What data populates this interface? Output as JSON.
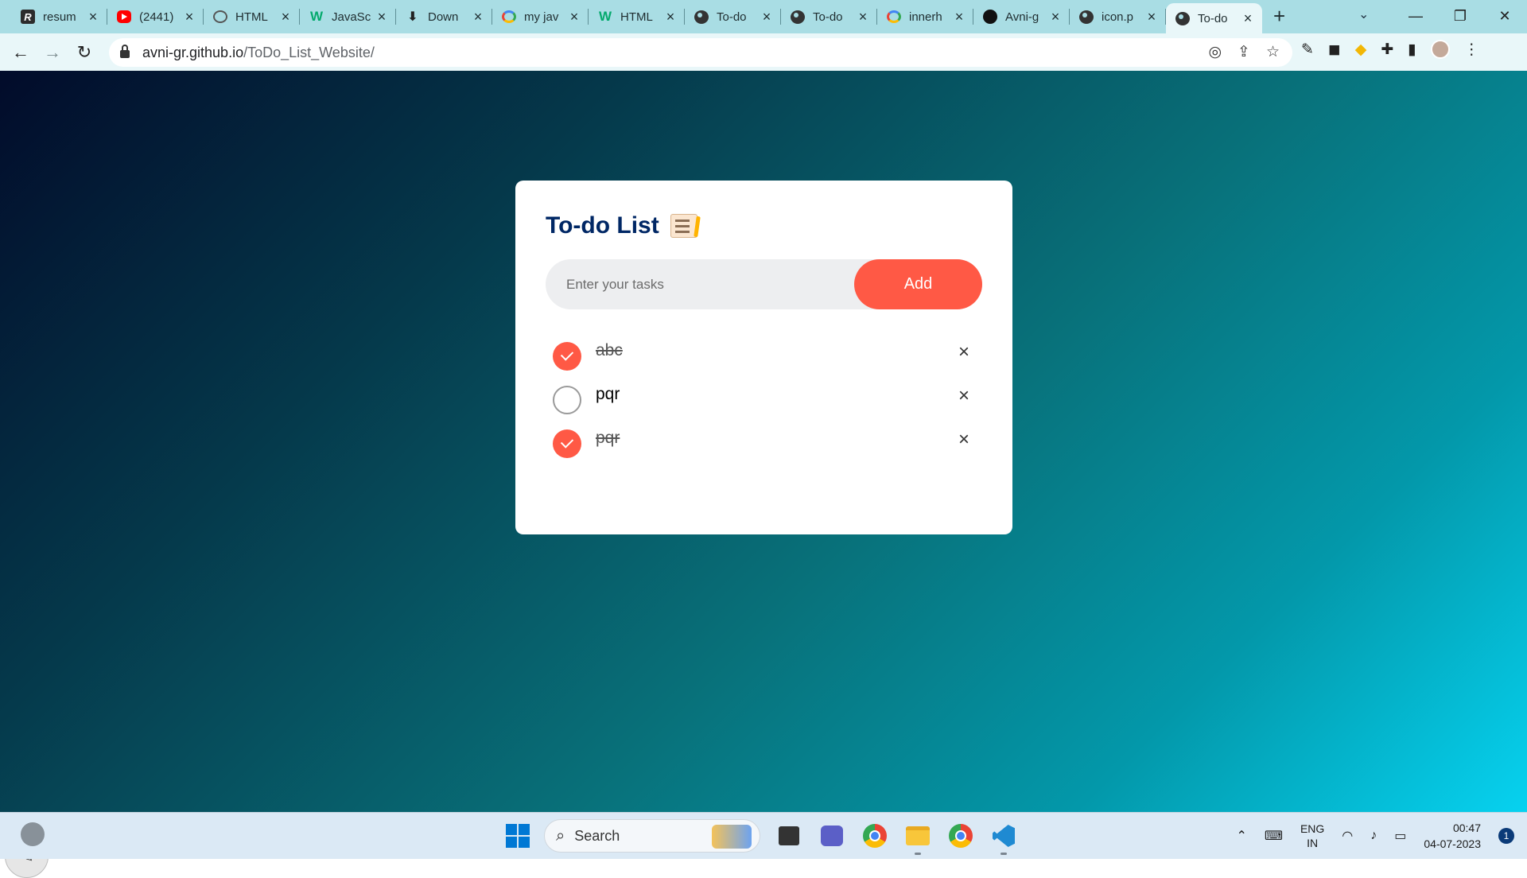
{
  "browser": {
    "tabs": [
      {
        "icon": "r-logo-icon",
        "label": "resum"
      },
      {
        "icon": "youtube-icon",
        "label": "(2441)"
      },
      {
        "icon": "chatgpt-icon",
        "label": "HTML"
      },
      {
        "icon": "w3schools-icon",
        "label": "JavaSc"
      },
      {
        "icon": "download-icon",
        "label": "Down"
      },
      {
        "icon": "google-icon",
        "label": "my jav"
      },
      {
        "icon": "w3schools-icon",
        "label": "HTML"
      },
      {
        "icon": "globe-icon",
        "label": "To-do"
      },
      {
        "icon": "globe-icon",
        "label": "To-do"
      },
      {
        "icon": "google-icon",
        "label": "innerh"
      },
      {
        "icon": "github-icon",
        "label": "Avni-g"
      },
      {
        "icon": "globe-icon",
        "label": "icon.p"
      },
      {
        "icon": "globe-icon",
        "label": "To-do",
        "active": true
      }
    ],
    "address": {
      "host": "avni-gr.github.io",
      "path": "/ToDo_List_Website/"
    }
  },
  "app": {
    "title": "To-do List",
    "input_placeholder": "Enter your tasks",
    "add_label": "Add",
    "tasks": [
      {
        "text": "abc",
        "done": true
      },
      {
        "text": "pqr",
        "done": false
      },
      {
        "text": "pqr",
        "done": true
      }
    ],
    "delete_glyph": "×"
  },
  "taskbar": {
    "search_label": "Search",
    "lang_line1": "ENG",
    "lang_line2": "IN",
    "time": "00:47",
    "date": "04-07-2023",
    "notification_count": "1"
  },
  "colors": {
    "accent": "#ff5945",
    "title": "#002765",
    "gradient_start": "#020b2a",
    "gradient_end": "#06d2f0"
  }
}
